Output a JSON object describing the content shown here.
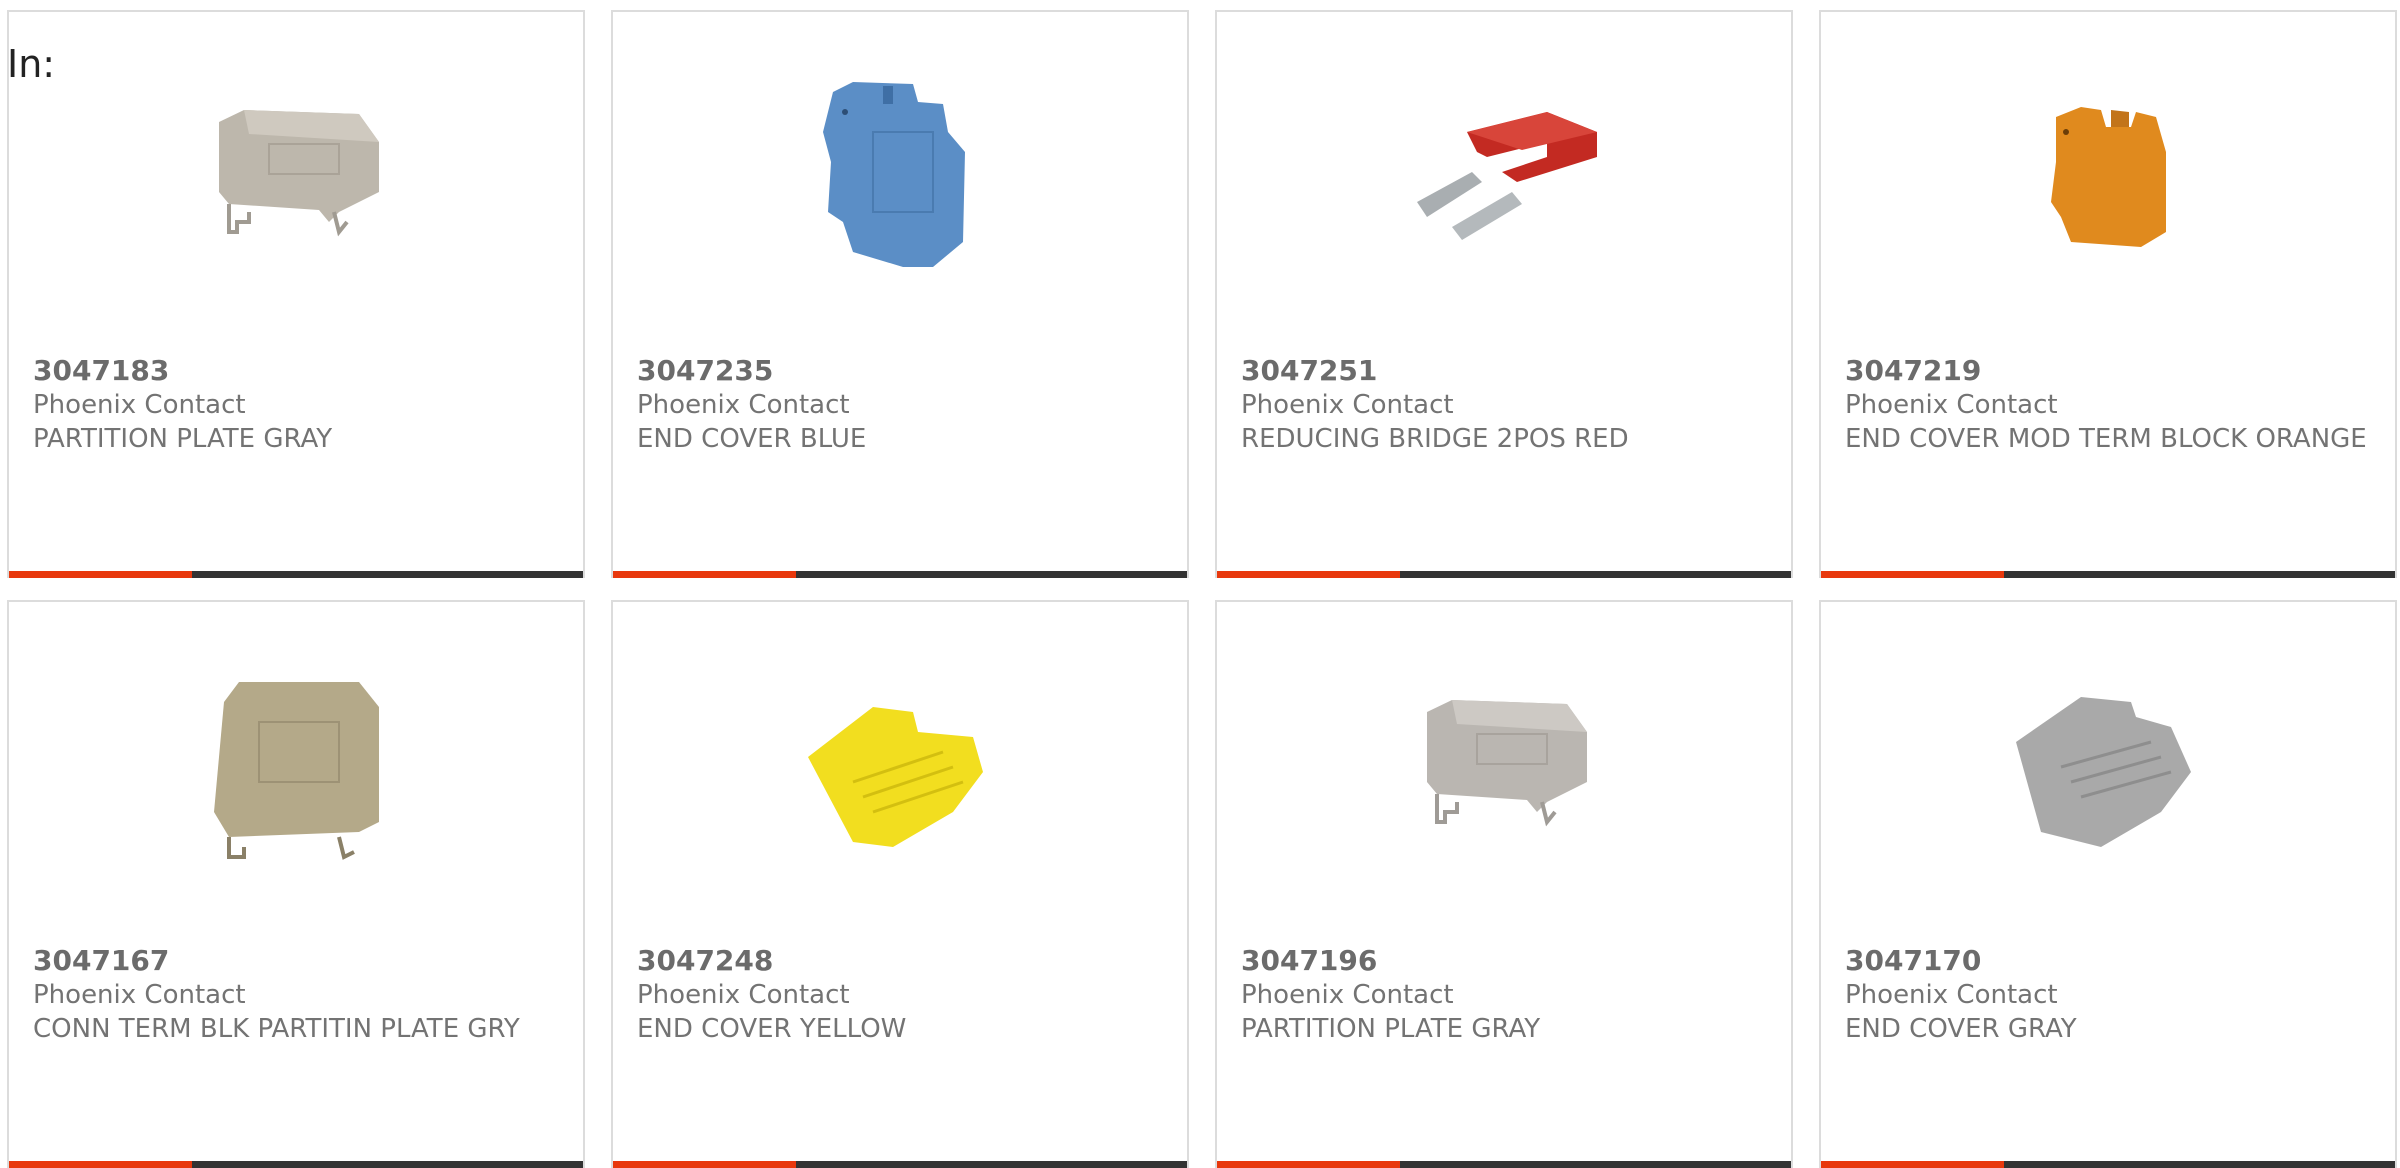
{
  "filter": {
    "label": "In:"
  },
  "accent_color": "#e8380d",
  "bar_color": "#333333",
  "products": [
    {
      "part_number": "3047183",
      "manufacturer": "Phoenix Contact",
      "description": "PARTITION PLATE GRAY",
      "image": "partition-plate-gray-image"
    },
    {
      "part_number": "3047235",
      "manufacturer": "Phoenix Contact",
      "description": "END COVER BLUE",
      "image": "end-cover-blue-image"
    },
    {
      "part_number": "3047251",
      "manufacturer": "Phoenix Contact",
      "description": "REDUCING BRIDGE 2POS RED",
      "image": "reducing-bridge-red-image"
    },
    {
      "part_number": "3047219",
      "manufacturer": "Phoenix Contact",
      "description": "END COVER MOD TERM BLOCK ORANGE",
      "image": "end-cover-orange-image"
    },
    {
      "part_number": "3047167",
      "manufacturer": "Phoenix Contact",
      "description": "CONN TERM BLK PARTITIN PLATE GRY",
      "image": "partition-plate-beige-image"
    },
    {
      "part_number": "3047248",
      "manufacturer": "Phoenix Contact",
      "description": "END COVER YELLOW",
      "image": "end-cover-yellow-image"
    },
    {
      "part_number": "3047196",
      "manufacturer": "Phoenix Contact",
      "description": "PARTITION PLATE GRAY",
      "image": "partition-plate-gray-image"
    },
    {
      "part_number": "3047170",
      "manufacturer": "Phoenix Contact",
      "description": "END COVER GRAY",
      "image": "end-cover-gray-image"
    }
  ]
}
